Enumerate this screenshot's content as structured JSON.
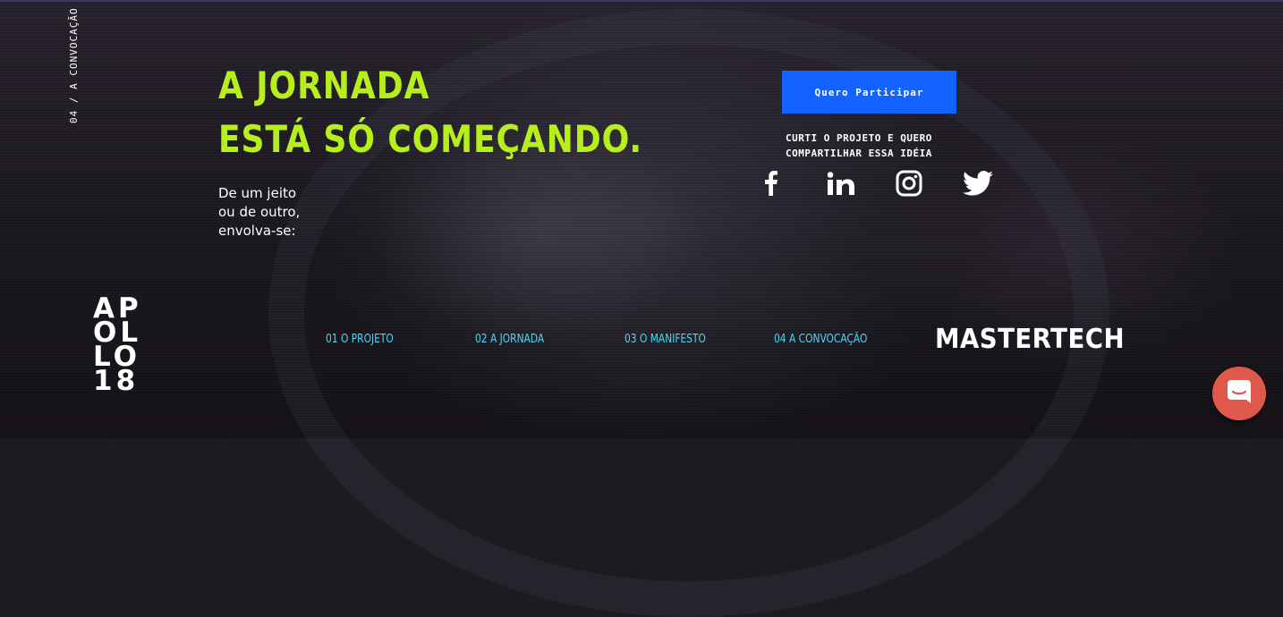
{
  "side_label": "04 / A CONVOCAÇÃO",
  "hero": {
    "headline_line1": "A JORNADA",
    "headline_line2": "ESTÁ SÓ COMEÇANDO.",
    "sub_line1": "De um jeito",
    "sub_line2": "ou de outro,",
    "sub_line3": "envolva-se:"
  },
  "cta": {
    "label": "Quero Participar"
  },
  "share": {
    "line1": "CURTI O PROJETO E QUERO",
    "line2": "COMPARTILHAR ESSA IDÉIA",
    "icons": [
      "facebook-icon",
      "linkedin-icon",
      "instagram-icon",
      "twitter-icon"
    ]
  },
  "logo": {
    "line1": "AP",
    "line2": "OL",
    "line3": "LO",
    "line4": "18"
  },
  "nav": {
    "item1": "01 O PROJETO",
    "item2": "02 A JORNADA",
    "item3": "03 O MANIFESTO",
    "item4": "04 A CONVOCAÇÃO"
  },
  "brand": "MASTERTECH",
  "colors": {
    "accent_green": "#b7ef1c",
    "cta_blue": "#1363ff",
    "nav_cyan": "#4fd6f2",
    "chat_red": "#e0584b"
  },
  "chat_widget": {
    "icon": "chat-icon"
  }
}
